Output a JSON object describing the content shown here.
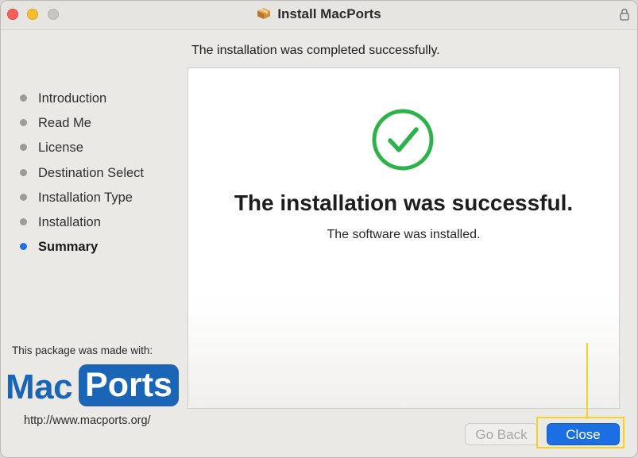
{
  "window": {
    "title": "Install MacPorts",
    "title_icon": "package-icon",
    "lock_icon": "lock-icon"
  },
  "header": {
    "text": "The installation was completed successfully."
  },
  "sidebar": {
    "steps": [
      {
        "label": "Introduction",
        "active": false
      },
      {
        "label": "Read Me",
        "active": false
      },
      {
        "label": "License",
        "active": false
      },
      {
        "label": "Destination Select",
        "active": false
      },
      {
        "label": "Installation Type",
        "active": false
      },
      {
        "label": "Installation",
        "active": false
      },
      {
        "label": "Summary",
        "active": true
      }
    ],
    "made_with": "This package was made with:",
    "logo": {
      "mac": "Mac",
      "ports": "Ports"
    },
    "url": "http://www.macports.org/"
  },
  "main": {
    "icon": "checkmark-circle-icon",
    "title": "The installation was successful.",
    "subtitle": "The software was installed."
  },
  "buttons": {
    "go_back": "Go Back",
    "close": "Close"
  },
  "colors": {
    "accent": "#1c6ee3",
    "success": "#2bb34a",
    "highlight": "#f5d21e",
    "logo": "#1a65b5"
  }
}
